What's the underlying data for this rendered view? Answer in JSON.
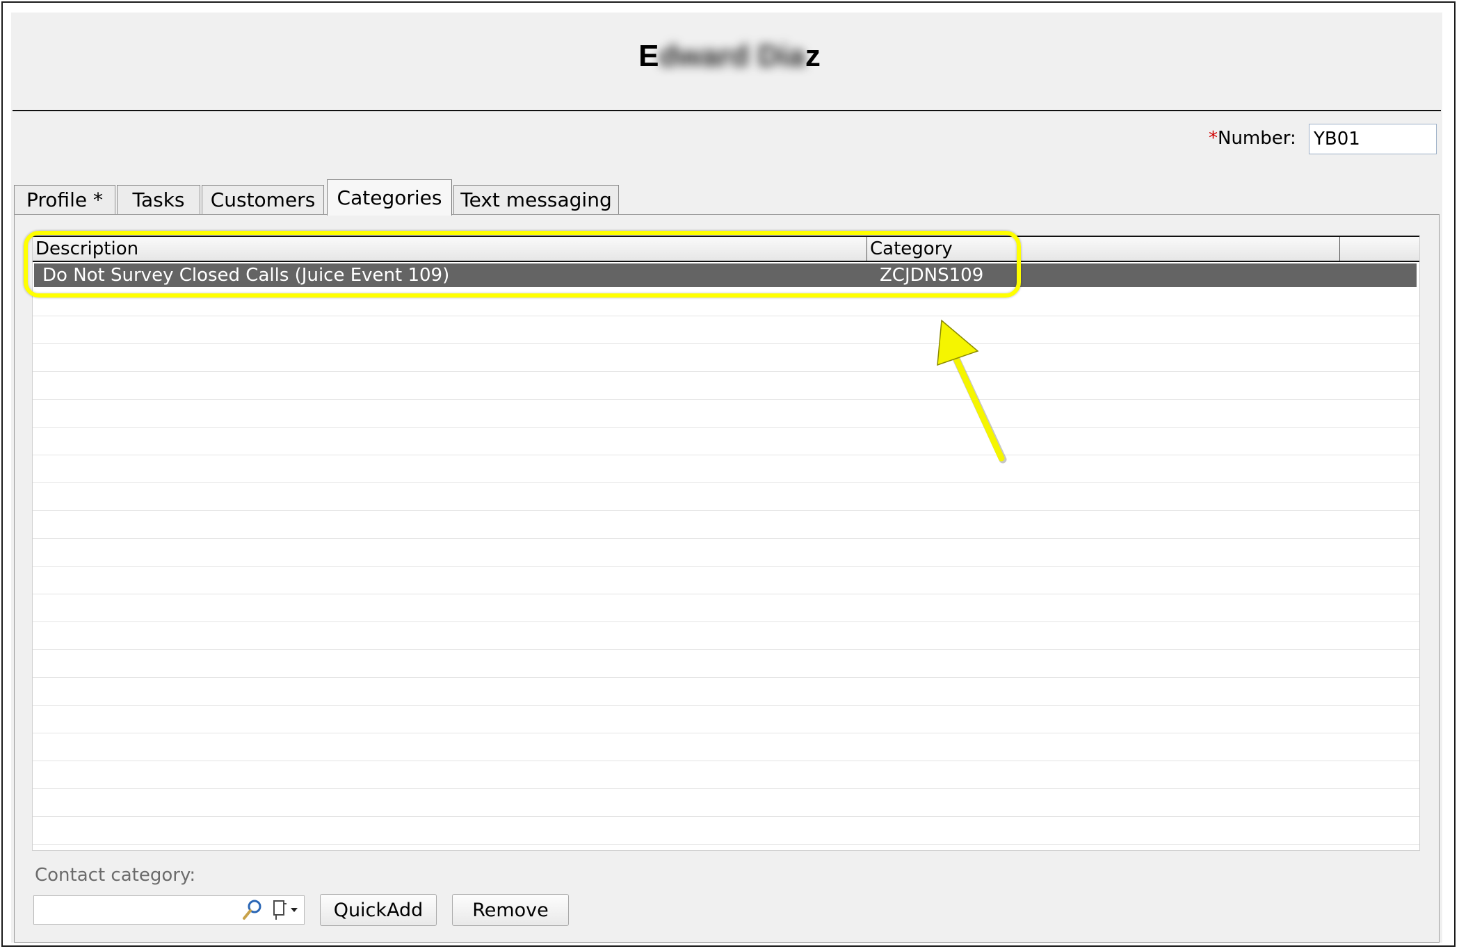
{
  "header": {
    "title_visible_first": "E",
    "title_blurred": "dward Dia",
    "title_visible_last": "z"
  },
  "number_field": {
    "required_mark": "*",
    "label": "Number:",
    "value": "YB01"
  },
  "tabs": [
    {
      "label": "Profile *",
      "active": false
    },
    {
      "label": "Tasks",
      "active": false
    },
    {
      "label": "Customers",
      "active": false
    },
    {
      "label": "Categories",
      "active": true
    },
    {
      "label": "Text messaging",
      "active": false
    }
  ],
  "grid": {
    "columns": [
      "Description",
      "Category"
    ],
    "rows": [
      {
        "description": "Do Not Survey Closed Calls (Juice Event 109)",
        "category": "ZCJDNS109",
        "selected": true
      }
    ]
  },
  "contact_category": {
    "label": "Contact category:",
    "value": ""
  },
  "buttons": {
    "quickadd": "QuickAdd",
    "remove": "Remove"
  },
  "icons": {
    "lookup": "magnifier-icon",
    "document_dropdown": "document-dropdown-icon"
  },
  "colors": {
    "highlight": "#ffff00",
    "selected_row": "#646464",
    "required": "#d00000"
  }
}
